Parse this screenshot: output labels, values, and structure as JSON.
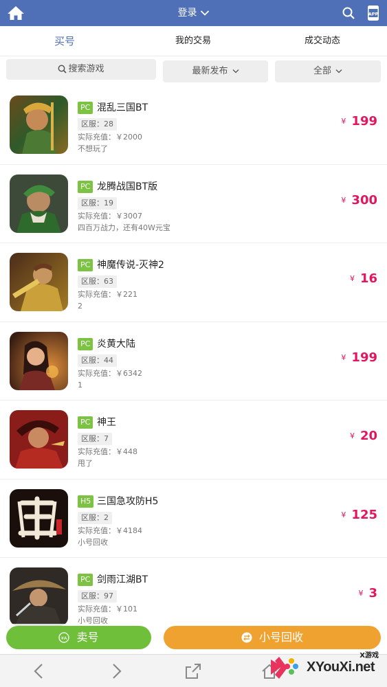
{
  "header": {
    "title": "登录",
    "app_badge": "APP",
    "color": "#4f6fb6"
  },
  "tabs": [
    {
      "label": "买号",
      "active": true
    },
    {
      "label": "我的交易",
      "active": false
    },
    {
      "label": "成交动态",
      "active": false
    }
  ],
  "filters": {
    "search_placeholder": "搜索游戏",
    "sort_label": "最新发布",
    "category_label": "全部"
  },
  "currency": "¥",
  "items": [
    {
      "platform": "PC",
      "name": "混乱三国BT",
      "server": "区服：28",
      "charge": "实际充值：￥2000",
      "note": "不想玩了",
      "price": "199",
      "icon": "warrior-green-gold"
    },
    {
      "platform": "PC",
      "name": "龙腾战国BT版",
      "server": "区服：19",
      "charge": "实际充值：￥3007",
      "note": "四百万战力，还有40W元宝",
      "price": "300",
      "icon": "general-green-helmet"
    },
    {
      "platform": "PC",
      "name": "神魔传说-灭神2",
      "server": "区服：63",
      "charge": "实际充值：￥221",
      "note": "2",
      "price": "16",
      "icon": "golden-armor-warrior"
    },
    {
      "platform": "PC",
      "name": "炎黄大陆",
      "server": "区服：44",
      "charge": "实际充值：￥6342",
      "note": "1",
      "price": "199",
      "icon": "heroine-portrait"
    },
    {
      "platform": "PC",
      "name": "神王",
      "server": "区服：7",
      "charge": "实际充值：￥448",
      "note": "甩了",
      "price": "20",
      "icon": "red-god-king"
    },
    {
      "platform": "H5",
      "name": "三国急攻防H5",
      "server": "区服：2",
      "charge": "实际充值：￥4184",
      "note": "小号回收",
      "price": "125",
      "icon": "sanguo-calligraphy"
    },
    {
      "platform": "PC",
      "name": "剑雨江湖BT",
      "server": "区服：97",
      "charge": "实际充值：￥101",
      "note": "小号回收",
      "price": "3",
      "icon": "straw-hat-swordsman"
    }
  ],
  "actions": {
    "sell_label": "卖号",
    "recycle_label": "小号回收",
    "sell_color": "#6fbf3a",
    "recycle_color": "#f0a231"
  },
  "price_color": "#e2165f",
  "tag_color": "#7cc243",
  "watermark": {
    "small": "X游戏",
    "big": "XYouXi.net"
  }
}
